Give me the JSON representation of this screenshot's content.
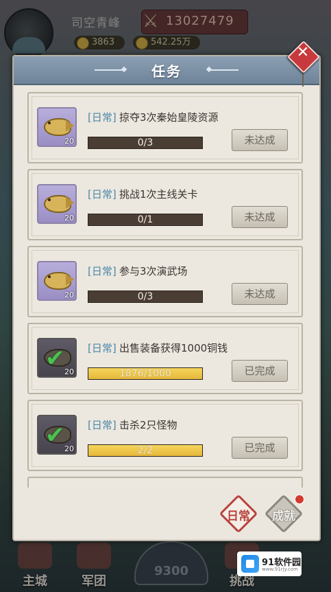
{
  "player": {
    "name": "司空青峰",
    "power": "13027479",
    "resource1": "3863",
    "resource2": "542.25万"
  },
  "panel": {
    "title": "任务",
    "close_label": "✕"
  },
  "tasks": [
    {
      "tag": "[日常]",
      "name": "掠夺3次秦始皇陵资源",
      "progress": "0/3",
      "progress_fraction": 0,
      "status": "未达成",
      "done": false,
      "qty": "20"
    },
    {
      "tag": "[日常]",
      "name": "挑战1次主线关卡",
      "progress": "0/1",
      "progress_fraction": 0,
      "status": "未达成",
      "done": false,
      "qty": "20"
    },
    {
      "tag": "[日常]",
      "name": "参与3次演武场",
      "progress": "0/3",
      "progress_fraction": 0,
      "status": "未达成",
      "done": false,
      "qty": "20"
    },
    {
      "tag": "[日常]",
      "name": "出售装备获得1000铜钱",
      "progress": "1876/1000",
      "progress_fraction": 1,
      "status": "已完成",
      "done": true,
      "qty": "20"
    },
    {
      "tag": "[日常]",
      "name": "击杀2只怪物",
      "progress": "2/2",
      "progress_fraction": 1,
      "status": "已完成",
      "done": true,
      "qty": "20"
    }
  ],
  "tabs": {
    "daily": "日常",
    "achievement": "成就"
  },
  "bottom_nav": {
    "main_city": "主城",
    "legion": "军团",
    "center": "9300",
    "challenge": "挑战"
  },
  "watermark": {
    "text": "91软件园",
    "sub": "www.91rjy.com"
  },
  "colors": {
    "header": "#7b8fa4",
    "tag": "#4a87a8",
    "progress_fill": "#f0c84a",
    "close": "#c8393d"
  }
}
